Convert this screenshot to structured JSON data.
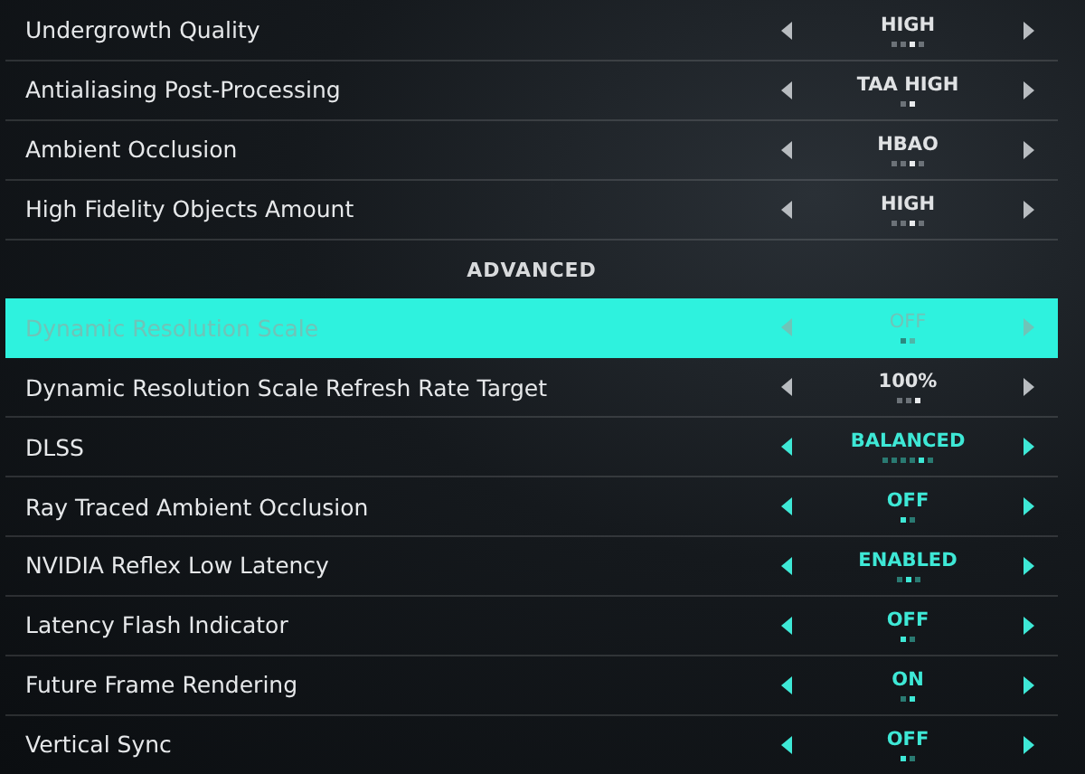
{
  "items": [
    {
      "kind": "setting",
      "label": "Undergrowth Quality",
      "value": "HIGH",
      "selected": false,
      "disabled": false,
      "accent": false,
      "steps": [
        {
          "selected": false
        },
        {
          "selected": false
        },
        {
          "selected": true
        },
        {
          "selected": false
        }
      ]
    },
    {
      "kind": "setting",
      "label": "Antialiasing Post-Processing",
      "value": "TAA HIGH",
      "selected": false,
      "disabled": false,
      "accent": false,
      "steps": [
        {
          "selected": false
        },
        {
          "selected": true
        }
      ]
    },
    {
      "kind": "setting",
      "label": "Ambient Occlusion",
      "value": "HBAO",
      "selected": false,
      "disabled": false,
      "accent": false,
      "steps": [
        {
          "selected": false
        },
        {
          "selected": false
        },
        {
          "selected": true
        },
        {
          "selected": false
        }
      ]
    },
    {
      "kind": "setting",
      "label": "High Fidelity Objects Amount",
      "value": "HIGH",
      "selected": false,
      "disabled": false,
      "accent": false,
      "steps": [
        {
          "selected": false
        },
        {
          "selected": false
        },
        {
          "selected": true
        },
        {
          "selected": false
        }
      ]
    },
    {
      "kind": "header",
      "label": "ADVANCED"
    },
    {
      "kind": "setting",
      "label": "Dynamic Resolution Scale",
      "value": "OFF",
      "selected": true,
      "disabled": true,
      "accent": false,
      "steps": [
        {
          "selected": true
        },
        {
          "selected": false
        }
      ]
    },
    {
      "kind": "setting",
      "label": "Dynamic Resolution Scale Refresh Rate Target",
      "value": "100%",
      "selected": false,
      "disabled": false,
      "accent": false,
      "steps": [
        {
          "selected": false
        },
        {
          "selected": false
        },
        {
          "selected": true
        }
      ]
    },
    {
      "kind": "setting",
      "label": "DLSS",
      "value": "BALANCED",
      "selected": false,
      "disabled": false,
      "accent": true,
      "steps": [
        {
          "selected": false
        },
        {
          "selected": false
        },
        {
          "selected": false
        },
        {
          "selected": false
        },
        {
          "selected": true
        },
        {
          "selected": false
        }
      ]
    },
    {
      "kind": "setting",
      "label": "Ray Traced Ambient Occlusion",
      "value": "OFF",
      "selected": false,
      "disabled": false,
      "accent": true,
      "steps": [
        {
          "selected": true
        },
        {
          "selected": false
        }
      ]
    },
    {
      "kind": "setting",
      "label": "NVIDIA Reflex Low Latency",
      "value": "ENABLED",
      "selected": false,
      "disabled": false,
      "accent": true,
      "steps": [
        {
          "selected": false
        },
        {
          "selected": true
        },
        {
          "selected": false
        }
      ]
    },
    {
      "kind": "setting",
      "label": "Latency Flash Indicator",
      "value": "OFF",
      "selected": false,
      "disabled": false,
      "accent": true,
      "steps": [
        {
          "selected": true
        },
        {
          "selected": false
        }
      ]
    },
    {
      "kind": "setting",
      "label": "Future Frame Rendering",
      "value": "ON",
      "selected": false,
      "disabled": false,
      "accent": true,
      "steps": [
        {
          "selected": false
        },
        {
          "selected": true
        }
      ]
    },
    {
      "kind": "setting",
      "label": "Vertical Sync",
      "value": "OFF",
      "selected": false,
      "disabled": false,
      "accent": true,
      "steps": [
        {
          "selected": true
        },
        {
          "selected": false
        }
      ]
    }
  ]
}
